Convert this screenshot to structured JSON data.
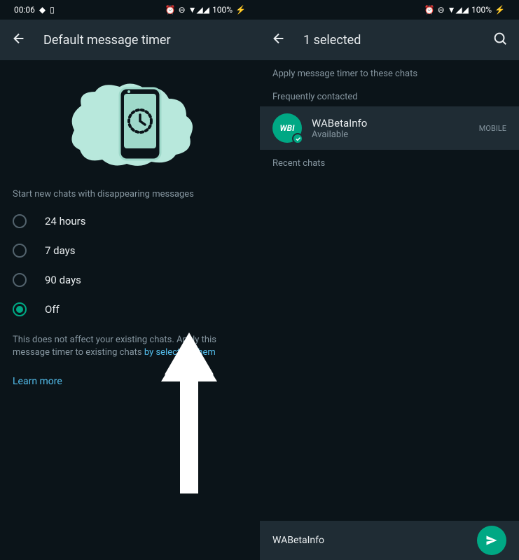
{
  "status": {
    "time": "00:06",
    "battery": "100%"
  },
  "left": {
    "title": "Default message timer",
    "section_label": "Start new chats with disappearing messages",
    "options": [
      {
        "label": "24 hours",
        "selected": false
      },
      {
        "label": "7 days",
        "selected": false
      },
      {
        "label": "90 days",
        "selected": false
      },
      {
        "label": "Off",
        "selected": true
      }
    ],
    "description_prefix": "This does not affect your existing chats. Apply this message timer to existing chats ",
    "description_link": "by selecting them",
    "learn_more": "Learn more"
  },
  "right": {
    "title": "1 selected",
    "apply_label": "Apply  message timer to these chats",
    "frequently_label": "Frequently contacted",
    "recent_label": "Recent chats",
    "contact": {
      "avatar_text": "WBI",
      "name": "WABetaInfo",
      "status": "Available",
      "type": "MOBILE"
    },
    "bottom_name": "WABetaInfo"
  }
}
